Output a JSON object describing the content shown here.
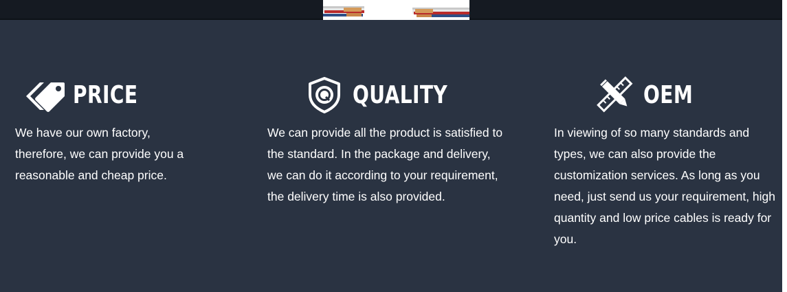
{
  "features": [
    {
      "id": "price",
      "icon": "price-tag-icon",
      "title": "PRICE",
      "text": "We have our own factory, therefore, we can provide you a reasonable and cheap price."
    },
    {
      "id": "quality",
      "icon": "quality-shield-icon",
      "title": "QUALITY",
      "text": "We can provide all the product is satisfied to the standard. In the package and delivery, we can do it according to your requirement, the delivery time is also provided."
    },
    {
      "id": "oem",
      "icon": "ruler-pencil-icon",
      "title": "OEM",
      "text": "In viewing of so many standards and types, we can also provide the customization services. As long as you need, just send us your requirement, high quantity and low price cables is ready for you."
    }
  ],
  "colors": {
    "panel_background": "#2a3342",
    "top_bar": "#151a22",
    "text": "#ffffff"
  }
}
